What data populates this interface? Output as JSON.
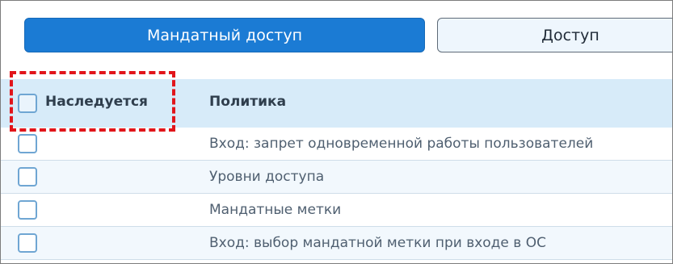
{
  "tabs": [
    {
      "label": "Мандатный доступ",
      "active": true
    },
    {
      "label": "Доступ",
      "active": false
    }
  ],
  "table": {
    "headers": {
      "inherit": "Наследуется",
      "policy": "Политика"
    },
    "rows": [
      {
        "checked": false,
        "policy": "Вход: запрет одновременной работы пользователей"
      },
      {
        "checked": false,
        "policy": "Уровни доступа"
      },
      {
        "checked": false,
        "policy": "Мандатные метки"
      },
      {
        "checked": false,
        "policy": "Вход: выбор мандатной метки при входе в ОС"
      }
    ]
  },
  "colors": {
    "accent": "#1b7bd4",
    "header_bg": "#d7ebf9",
    "highlight": "#e1151b"
  }
}
